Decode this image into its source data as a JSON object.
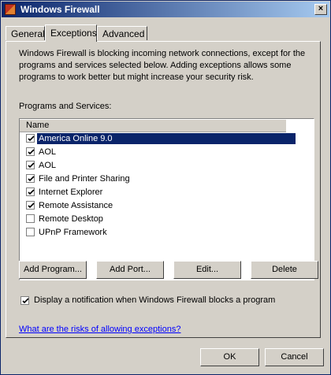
{
  "window": {
    "title": "Windows Firewall",
    "close_glyph": "×"
  },
  "tabs": [
    {
      "label": "General"
    },
    {
      "label": "Exceptions"
    },
    {
      "label": "Advanced"
    }
  ],
  "exceptions": {
    "description": "Windows Firewall is blocking incoming network connections, except for the programs and services selected below. Adding exceptions allows some programs to work better but might increase your security risk.",
    "list_label": "Programs and Services:",
    "column_header": "Name",
    "items": [
      {
        "label": "America Online 9.0",
        "checked": true,
        "selected": true
      },
      {
        "label": "AOL",
        "checked": true,
        "selected": false
      },
      {
        "label": "AOL",
        "checked": true,
        "selected": false
      },
      {
        "label": "File and Printer Sharing",
        "checked": true,
        "selected": false
      },
      {
        "label": "Internet Explorer",
        "checked": true,
        "selected": false
      },
      {
        "label": "Remote Assistance",
        "checked": true,
        "selected": false
      },
      {
        "label": "Remote Desktop",
        "checked": false,
        "selected": false
      },
      {
        "label": "UPnP Framework",
        "checked": false,
        "selected": false
      }
    ],
    "buttons": {
      "add_program": "Add Program...",
      "add_port": "Add Port...",
      "edit": "Edit...",
      "delete": "Delete"
    },
    "notification": {
      "label": "Display a notification when Windows Firewall blocks a program",
      "checked": true
    },
    "risk_link": "What are the risks of allowing exceptions?"
  },
  "footer": {
    "ok": "OK",
    "cancel": "Cancel"
  },
  "colors": {
    "selection": "#0a246a",
    "title_start": "#0a246a",
    "title_end": "#a6caf0",
    "link": "#0000ff"
  }
}
